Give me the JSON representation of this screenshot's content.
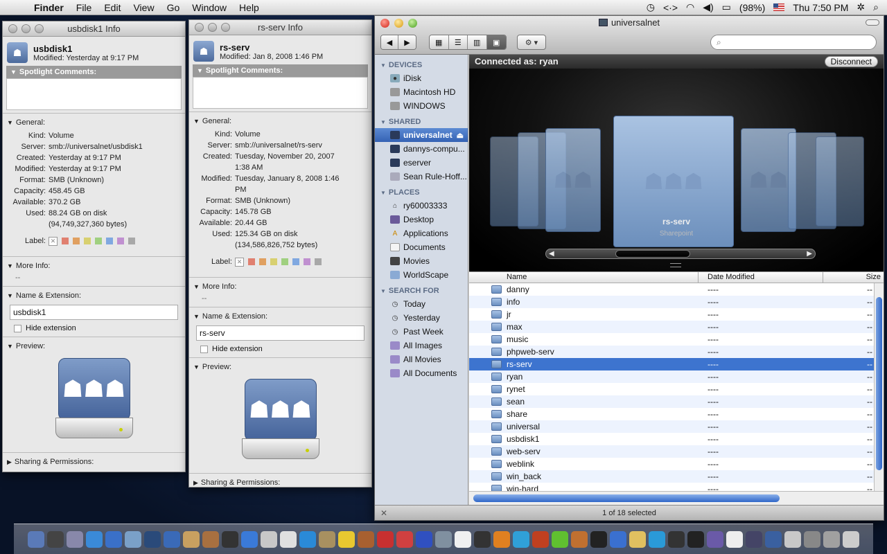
{
  "menubar": {
    "app": "Finder",
    "items": [
      "File",
      "Edit",
      "View",
      "Go",
      "Window",
      "Help"
    ],
    "battery": "(98%)",
    "clock": "Thu 7:50 PM"
  },
  "info1": {
    "title": "usbdisk1 Info",
    "name": "usbdisk1",
    "modified_line": "Modified: Yesterday at 9:17 PM",
    "spotlight": "Spotlight Comments:",
    "general": "General:",
    "rows": [
      {
        "k": "Kind:",
        "v": "Volume"
      },
      {
        "k": "Server:",
        "v": "smb://universalnet/usbdisk1"
      },
      {
        "k": "Created:",
        "v": "Yesterday at 9:17 PM"
      },
      {
        "k": "Modified:",
        "v": "Yesterday at 9:17 PM"
      },
      {
        "k": "Format:",
        "v": "SMB (Unknown)"
      },
      {
        "k": "Capacity:",
        "v": "458.45 GB"
      },
      {
        "k": "Available:",
        "v": "370.2 GB"
      },
      {
        "k": "Used:",
        "v": "88.24 GB on disk"
      },
      {
        "k": "",
        "v": "(94,749,327,360 bytes)"
      }
    ],
    "label": "Label:",
    "more_info": "More Info:",
    "more_info_value": "--",
    "name_ext": "Name & Extension:",
    "name_value": "usbdisk1",
    "hide_ext": "Hide extension",
    "preview": "Preview:",
    "sharing": "Sharing & Permissions:"
  },
  "info2": {
    "title": "rs-serv Info",
    "name": "rs-serv",
    "modified_line": "Modified: Jan 8, 2008 1:46 PM",
    "spotlight": "Spotlight Comments:",
    "general": "General:",
    "rows": [
      {
        "k": "Kind:",
        "v": "Volume"
      },
      {
        "k": "Server:",
        "v": "smb://universalnet/rs-serv"
      },
      {
        "k": "Created:",
        "v": "Tuesday, November 20, 2007"
      },
      {
        "k": "",
        "v": "1:38 AM"
      },
      {
        "k": "Modified:",
        "v": "Tuesday, January 8, 2008 1:46"
      },
      {
        "k": "",
        "v": "PM"
      },
      {
        "k": "Format:",
        "v": "SMB (Unknown)"
      },
      {
        "k": "Capacity:",
        "v": "145.78 GB"
      },
      {
        "k": "Available:",
        "v": "20.44 GB"
      },
      {
        "k": "Used:",
        "v": "125.34 GB on disk"
      },
      {
        "k": "",
        "v": "(134,586,826,752 bytes)"
      }
    ],
    "label": "Label:",
    "more_info": "More Info:",
    "more_info_value": "--",
    "name_ext": "Name & Extension:",
    "name_value": "rs-serv",
    "hide_ext": "Hide extension",
    "preview": "Preview:",
    "sharing": "Sharing & Permissions:"
  },
  "label_colors": [
    "#e08070",
    "#e0a060",
    "#d8d070",
    "#a0d080",
    "#80a8e0",
    "#c090d0",
    "#a8a8a8"
  ],
  "finder": {
    "title": "universalnet",
    "connected": "Connected as: ryan",
    "disconnect": "Disconnect",
    "sidebar": {
      "devices": {
        "label": "DEVICES",
        "items": [
          "iDisk",
          "Macintosh HD",
          "WINDOWS"
        ]
      },
      "shared": {
        "label": "SHARED",
        "items": [
          "universalnet",
          "dannys-compu...",
          "eserver",
          "Sean Rule-Hoff..."
        ]
      },
      "places": {
        "label": "PLACES",
        "items": [
          "ry60003333",
          "Desktop",
          "Applications",
          "Documents",
          "Movies",
          "WorldScape"
        ]
      },
      "search": {
        "label": "SEARCH FOR",
        "items": [
          "Today",
          "Yesterday",
          "Past Week",
          "All Images",
          "All Movies",
          "All Documents"
        ]
      }
    },
    "coverflow": {
      "name": "rs-serv",
      "subtitle": "Sharepoint"
    },
    "columns": {
      "name": "Name",
      "date": "Date Modified",
      "size": "Size"
    },
    "files": [
      {
        "name": "danny",
        "date": "----",
        "size": "--"
      },
      {
        "name": "info",
        "date": "----",
        "size": "--"
      },
      {
        "name": "jr",
        "date": "----",
        "size": "--"
      },
      {
        "name": "max",
        "date": "----",
        "size": "--"
      },
      {
        "name": "music",
        "date": "----",
        "size": "--"
      },
      {
        "name": "phpweb-serv",
        "date": "----",
        "size": "--"
      },
      {
        "name": "rs-serv",
        "date": "----",
        "size": "--"
      },
      {
        "name": "ryan",
        "date": "----",
        "size": "--"
      },
      {
        "name": "rynet",
        "date": "----",
        "size": "--"
      },
      {
        "name": "sean",
        "date": "----",
        "size": "--"
      },
      {
        "name": "share",
        "date": "----",
        "size": "--"
      },
      {
        "name": "universal",
        "date": "----",
        "size": "--"
      },
      {
        "name": "usbdisk1",
        "date": "----",
        "size": "--"
      },
      {
        "name": "web-serv",
        "date": "----",
        "size": "--"
      },
      {
        "name": "weblink",
        "date": "----",
        "size": "--"
      },
      {
        "name": "win_back",
        "date": "----",
        "size": "--"
      },
      {
        "name": "win-hard",
        "date": "----",
        "size": "--"
      }
    ],
    "selected_index": 6,
    "status": "1 of 18 selected"
  },
  "dock_colors": [
    "#5a7ab8",
    "#444",
    "#8888aa",
    "#3a8ad8",
    "#3a70c8",
    "#7aa0c8",
    "#2a4a7a",
    "#3a6ab8",
    "#c8a060",
    "#a87040",
    "#333",
    "#3a7ad8",
    "#c8c8c8",
    "#e0e0e0",
    "#2a8ad8",
    "#a89060",
    "#e8c830",
    "#a86030",
    "#c83030",
    "#d04040",
    "#3050c0",
    "#8090a0",
    "#f0f0f0",
    "#333",
    "#e08020",
    "#30a0d8",
    "#c04020",
    "#60c030",
    "#c07030",
    "#222",
    "#3a70d0",
    "#e0c060",
    "#2a9ad8",
    "#333",
    "#222",
    "#6a5aa8",
    "#eee",
    "#446",
    "#3a60a0",
    "#c8c8c8",
    "#888",
    "#a0a0a0",
    "#ccc"
  ]
}
